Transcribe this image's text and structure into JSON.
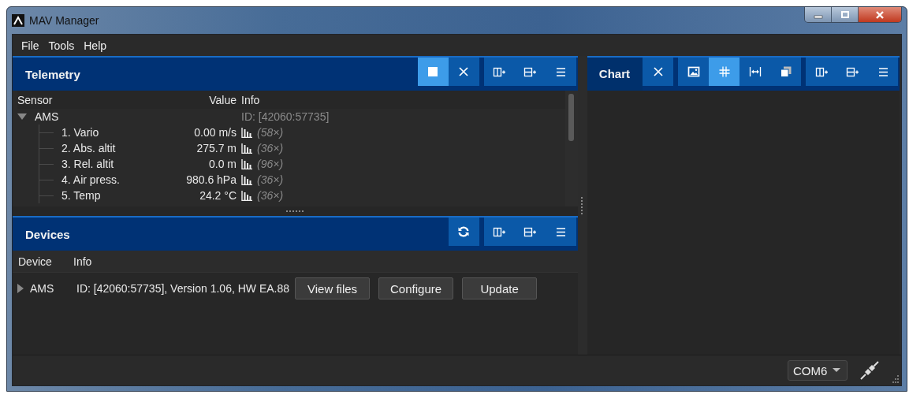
{
  "window": {
    "title": "MAV Manager"
  },
  "menu": [
    "File",
    "Tools",
    "Help"
  ],
  "telemetry": {
    "title": "Telemetry",
    "toolbar": [
      [
        {
          "kind": "stop",
          "selected": true
        },
        {
          "kind": "close",
          "selected": false
        }
      ],
      [
        {
          "kind": "add-column",
          "selected": false
        },
        {
          "kind": "add-row",
          "selected": false
        },
        {
          "kind": "menu",
          "selected": false
        }
      ]
    ],
    "columns": [
      "Sensor",
      "Value",
      "Info"
    ],
    "tree": [
      {
        "name": "AMS",
        "info": "ID: [42060:57735]",
        "expanded": true,
        "children": [
          {
            "name": "1. Vario",
            "value": "0.00 m/s",
            "info": "(58×)"
          },
          {
            "name": "2. Abs. altit",
            "value": "275.7 m",
            "info": "(36×)"
          },
          {
            "name": "3. Rel. altit",
            "value": "0.0 m",
            "info": "(96×)"
          },
          {
            "name": "4. Air press.",
            "value": "980.6 hPa",
            "info": "(36×)"
          },
          {
            "name": "5. Temp",
            "value": "24.2 °C",
            "info": "(36×)"
          }
        ]
      }
    ]
  },
  "devices": {
    "title": "Devices",
    "toolbar": [
      [
        {
          "kind": "refresh",
          "selected": false
        }
      ],
      [
        {
          "kind": "add-column",
          "selected": false
        },
        {
          "kind": "add-row",
          "selected": false
        },
        {
          "kind": "menu",
          "selected": false
        }
      ]
    ],
    "columns": [
      "Device",
      "Info"
    ],
    "rows": [
      {
        "name": "AMS",
        "expanded": false,
        "info": "ID: [42060:57735], Version  1.06, HW EA.88",
        "actions": [
          "View files",
          "Configure",
          "Update"
        ]
      }
    ]
  },
  "chart": {
    "title": "Chart",
    "toolbar": [
      [
        {
          "kind": "close",
          "selected": false
        }
      ],
      [
        {
          "kind": "image",
          "selected": false
        },
        {
          "kind": "grid",
          "selected": true
        },
        {
          "kind": "fit-width",
          "selected": false
        },
        {
          "kind": "copy",
          "selected": false
        }
      ],
      [
        {
          "kind": "add-column",
          "selected": false
        },
        {
          "kind": "add-row",
          "selected": false
        },
        {
          "kind": "menu",
          "selected": false
        }
      ]
    ]
  },
  "status_bar": {
    "port": "COM6"
  }
}
